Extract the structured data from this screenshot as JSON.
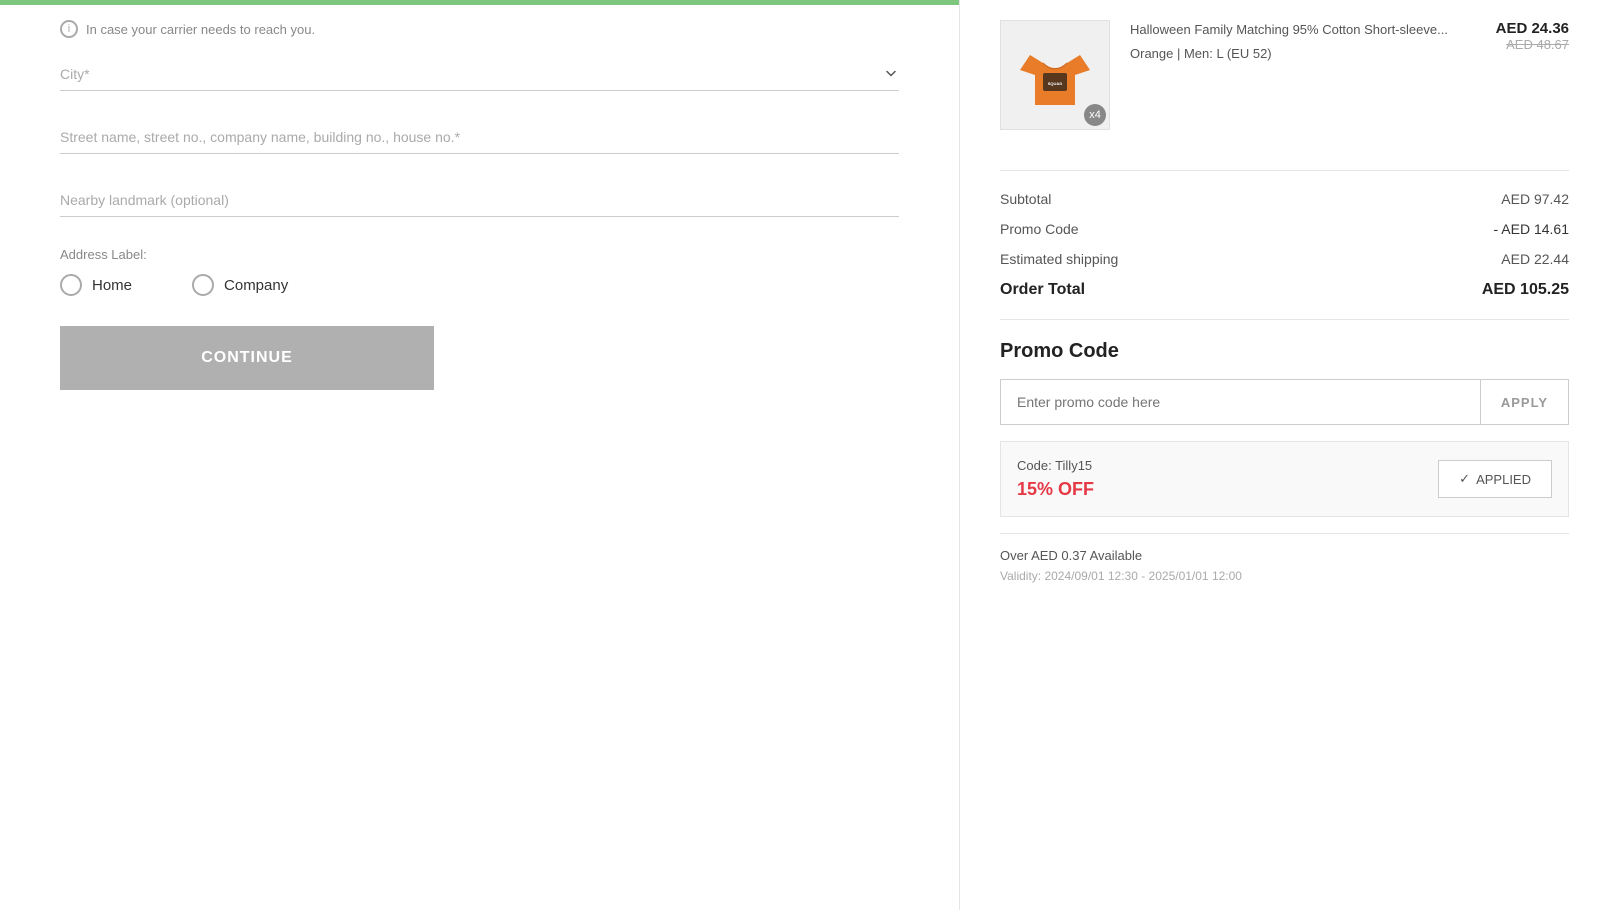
{
  "page": {
    "top_bar_color": "#7dc67e"
  },
  "left_panel": {
    "info_notice": "In case your carrier needs to reach you.",
    "city_placeholder": "City*",
    "street_placeholder": "Street name, street no., company name, building no., house no.*",
    "landmark_placeholder": "Nearby landmark (optional)",
    "address_label_title": "Address Label:",
    "radio_home": "Home",
    "radio_company": "Company",
    "continue_button": "CONTINUE"
  },
  "right_panel": {
    "product": {
      "title": "Halloween Family Matching 95% Cotton Short-sleeve...",
      "variant": "Orange | Men: L (EU 52)",
      "price_current": "AED 24.36",
      "price_original": "AED 48.67",
      "quantity": "x4"
    },
    "order_summary": {
      "subtotal_label": "Subtotal",
      "subtotal_value": "AED 97.42",
      "promo_label": "Promo Code",
      "promo_value": "- AED 14.61",
      "shipping_label": "Estimated shipping",
      "shipping_value": "AED 22.44",
      "total_label": "Order Total",
      "total_value": "AED 105.25"
    },
    "promo_section": {
      "title": "Promo Code",
      "input_placeholder": "Enter promo code here",
      "apply_button": "APPLY",
      "applied_code_label": "Code: Tilly15",
      "applied_discount": "15% OFF",
      "applied_button": "APPLIED",
      "available_text": "Over AED 0.37 Available",
      "validity_text": "Validity: 2024/09/01 12:30 - 2025/01/01 12:00"
    }
  }
}
